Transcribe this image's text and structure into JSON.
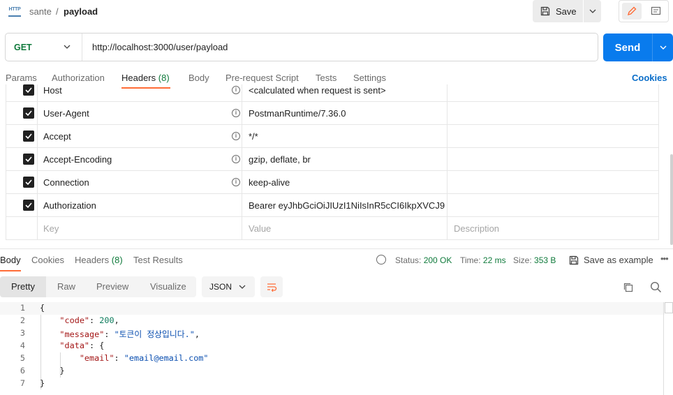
{
  "breadcrumb": {
    "parent": "sante",
    "separator": "/",
    "current": "payload"
  },
  "toolbar": {
    "save_label": "Save"
  },
  "request": {
    "method": "GET",
    "url": "http://localhost:3000/user/payload",
    "send_label": "Send"
  },
  "request_tabs": {
    "params": "Params",
    "authorization": "Authorization",
    "headers": "Headers",
    "headers_count": "(8)",
    "body": "Body",
    "prerequest": "Pre-request Script",
    "tests": "Tests",
    "settings": "Settings",
    "cookies": "Cookies"
  },
  "headers_table": {
    "rows": [
      {
        "key": "Host",
        "value": "<calculated when request is sent>",
        "info": true,
        "checked": true
      },
      {
        "key": "User-Agent",
        "value": "PostmanRuntime/7.36.0",
        "info": true,
        "checked": true
      },
      {
        "key": "Accept",
        "value": "*/*",
        "info": true,
        "checked": true
      },
      {
        "key": "Accept-Encoding",
        "value": "gzip, deflate, br",
        "info": true,
        "checked": true
      },
      {
        "key": "Connection",
        "value": "keep-alive",
        "info": true,
        "checked": true
      },
      {
        "key": "Authorization",
        "value": "Bearer eyJhbGciOiJIUzI1NiIsInR5cCI6IkpXVCJ9....",
        "info": false,
        "checked": true
      }
    ],
    "placeholders": {
      "key": "Key",
      "value": "Value",
      "description": "Description"
    }
  },
  "response_tabs": {
    "body": "Body",
    "cookies": "Cookies",
    "headers": "Headers",
    "headers_count": "(8)",
    "test_results": "Test Results"
  },
  "response_status": {
    "status_label": "Status:",
    "status_value": "200 OK",
    "time_label": "Time:",
    "time_value": "22 ms",
    "size_label": "Size:",
    "size_value": "353 B",
    "save_example": "Save as example"
  },
  "viewer": {
    "modes": [
      "Pretty",
      "Raw",
      "Preview",
      "Visualize"
    ],
    "active_mode": "Pretty",
    "format": "JSON"
  },
  "response_body": {
    "line_numbers": [
      "1",
      "2",
      "3",
      "4",
      "5",
      "6",
      "7"
    ],
    "open_brace": "{",
    "code_key": "\"code\"",
    "code_value": "200",
    "message_key": "\"message\"",
    "message_value": "\"토큰이 정상입니다.\"",
    "data_key": "\"data\"",
    "data_open": "{",
    "email_key": "\"email\"",
    "email_value": "\"email@email.com\"",
    "data_close": "}",
    "close_brace": "}"
  },
  "colors": {
    "accent": "#ff6c37",
    "send": "#097bed",
    "method": "#0f7a3b",
    "link": "#0b6ec9"
  }
}
